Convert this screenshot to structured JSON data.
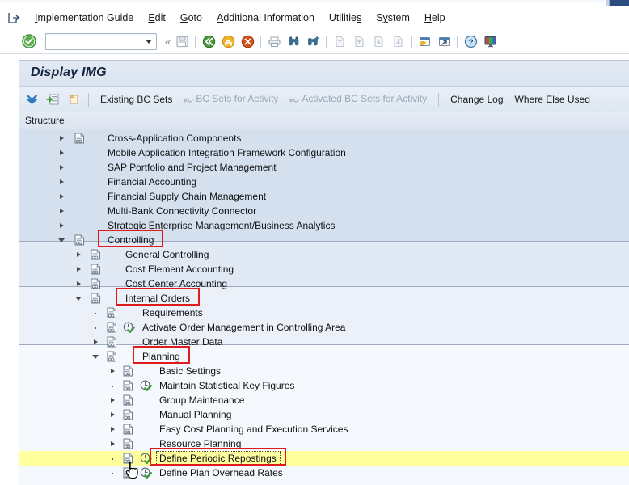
{
  "window": {
    "title": "Display IMG"
  },
  "menubar": {
    "launch_icon": "launchpad-icon",
    "items": [
      {
        "label": "Implementation Guide",
        "accel": "I"
      },
      {
        "label": "Edit",
        "accel": "E"
      },
      {
        "label": "Goto",
        "accel": "G"
      },
      {
        "label": "Additional Information",
        "accel": "A"
      },
      {
        "label": "Utilities",
        "accel": "s"
      },
      {
        "label": "System",
        "accel": "y"
      },
      {
        "label": "Help",
        "accel": "H"
      }
    ]
  },
  "toolbar": {
    "enter_icon": "green-check-enter-icon",
    "command_field_value": "",
    "command_field_placeholder": "",
    "dropdown_icon": "chevron-down-icon",
    "collapse_icon": "double-chevron-left-icon",
    "icons": [
      "save-icon",
      "back-green-arrow-icon",
      "exit-yellow-arrow-icon",
      "cancel-red-x-icon",
      "print-icon",
      "find-binoculars-icon",
      "find-next-binoculars-icon",
      "first-page-icon",
      "previous-page-icon",
      "next-page-icon",
      "last-page-icon",
      "create-session-icon",
      "create-shortcut-icon",
      "help-icon",
      "customize-layout-icon"
    ]
  },
  "app_toolbar": {
    "icons": [
      "collapse-all-icon",
      "expand-node-icon",
      "note-icon"
    ],
    "buttons": [
      {
        "label": "Existing BC Sets",
        "disabled": false,
        "icon": ""
      },
      {
        "label": "BC Sets for Activity",
        "disabled": true,
        "icon": "bc-set-icon"
      },
      {
        "label": "Activated BC Sets for Activity",
        "disabled": true,
        "icon": "bc-set-icon"
      },
      {
        "label": "Change Log",
        "disabled": false,
        "icon": ""
      },
      {
        "label": "Where Else Used",
        "disabled": false,
        "icon": ""
      }
    ]
  },
  "structure": {
    "column_header": "Structure",
    "highlight_color": "#ffff9e",
    "annotation_color": "#e01b1b",
    "rows": [
      {
        "label": "Cross-Application Components",
        "level": 0,
        "twisty": "right",
        "doc": true,
        "activity": false,
        "highlight": false,
        "boxed": false
      },
      {
        "label": "Mobile Application Integration Framework Configuration",
        "level": 0,
        "twisty": "right",
        "doc": false,
        "activity": false,
        "highlight": false,
        "boxed": false
      },
      {
        "label": "SAP Portfolio and Project Management",
        "level": 0,
        "twisty": "right",
        "doc": false,
        "activity": false,
        "highlight": false,
        "boxed": false
      },
      {
        "label": "Financial Accounting",
        "level": 0,
        "twisty": "right",
        "doc": false,
        "activity": false,
        "highlight": false,
        "boxed": false
      },
      {
        "label": "Financial Supply Chain Management",
        "level": 0,
        "twisty": "right",
        "doc": false,
        "activity": false,
        "highlight": false,
        "boxed": false
      },
      {
        "label": "Multi-Bank Connectivity Connector",
        "level": 0,
        "twisty": "right",
        "doc": false,
        "activity": false,
        "highlight": false,
        "boxed": false
      },
      {
        "label": "Strategic Enterprise Management/Business Analytics",
        "level": 0,
        "twisty": "right",
        "doc": false,
        "activity": false,
        "highlight": false,
        "boxed": false
      },
      {
        "label": "Controlling",
        "level": 0,
        "twisty": "down",
        "doc": true,
        "activity": false,
        "highlight": false,
        "boxed": true
      },
      {
        "label": "General Controlling",
        "level": 1,
        "twisty": "right",
        "doc": true,
        "activity": false,
        "highlight": false,
        "boxed": false
      },
      {
        "label": "Cost Element Accounting",
        "level": 1,
        "twisty": "right",
        "doc": true,
        "activity": false,
        "highlight": false,
        "boxed": false
      },
      {
        "label": "Cost Center Accounting",
        "level": 1,
        "twisty": "right",
        "doc": true,
        "activity": false,
        "highlight": false,
        "boxed": false
      },
      {
        "label": "Internal Orders",
        "level": 1,
        "twisty": "down",
        "doc": true,
        "activity": false,
        "highlight": false,
        "boxed": true
      },
      {
        "label": "Requirements",
        "level": 2,
        "twisty": "dot",
        "doc": true,
        "activity": false,
        "highlight": false,
        "boxed": false
      },
      {
        "label": "Activate Order Management in Controlling Area",
        "level": 2,
        "twisty": "dot",
        "doc": true,
        "activity": true,
        "highlight": false,
        "boxed": false
      },
      {
        "label": "Order Master Data",
        "level": 2,
        "twisty": "right",
        "doc": true,
        "activity": false,
        "highlight": false,
        "boxed": false
      },
      {
        "label": "Planning",
        "level": 2,
        "twisty": "down",
        "doc": true,
        "activity": false,
        "highlight": false,
        "boxed": true
      },
      {
        "label": "Basic Settings",
        "level": 3,
        "twisty": "right",
        "doc": true,
        "activity": false,
        "highlight": false,
        "boxed": false
      },
      {
        "label": "Maintain Statistical Key Figures",
        "level": 3,
        "twisty": "dot",
        "doc": true,
        "activity": true,
        "highlight": false,
        "boxed": false
      },
      {
        "label": "Group Maintenance",
        "level": 3,
        "twisty": "right",
        "doc": true,
        "activity": false,
        "highlight": false,
        "boxed": false
      },
      {
        "label": "Manual Planning",
        "level": 3,
        "twisty": "right",
        "doc": true,
        "activity": false,
        "highlight": false,
        "boxed": false
      },
      {
        "label": "Easy Cost Planning and Execution Services",
        "level": 3,
        "twisty": "right",
        "doc": true,
        "activity": false,
        "highlight": false,
        "boxed": false
      },
      {
        "label": "Resource Planning",
        "level": 3,
        "twisty": "right",
        "doc": true,
        "activity": false,
        "highlight": false,
        "boxed": false
      },
      {
        "label": "Define Periodic Repostings",
        "level": 3,
        "twisty": "dot",
        "doc": true,
        "activity": true,
        "highlight": true,
        "boxed": true
      },
      {
        "label": "Define Plan Overhead Rates",
        "level": 3,
        "twisty": "dot",
        "doc": true,
        "activity": true,
        "highlight": false,
        "boxed": false
      }
    ]
  }
}
